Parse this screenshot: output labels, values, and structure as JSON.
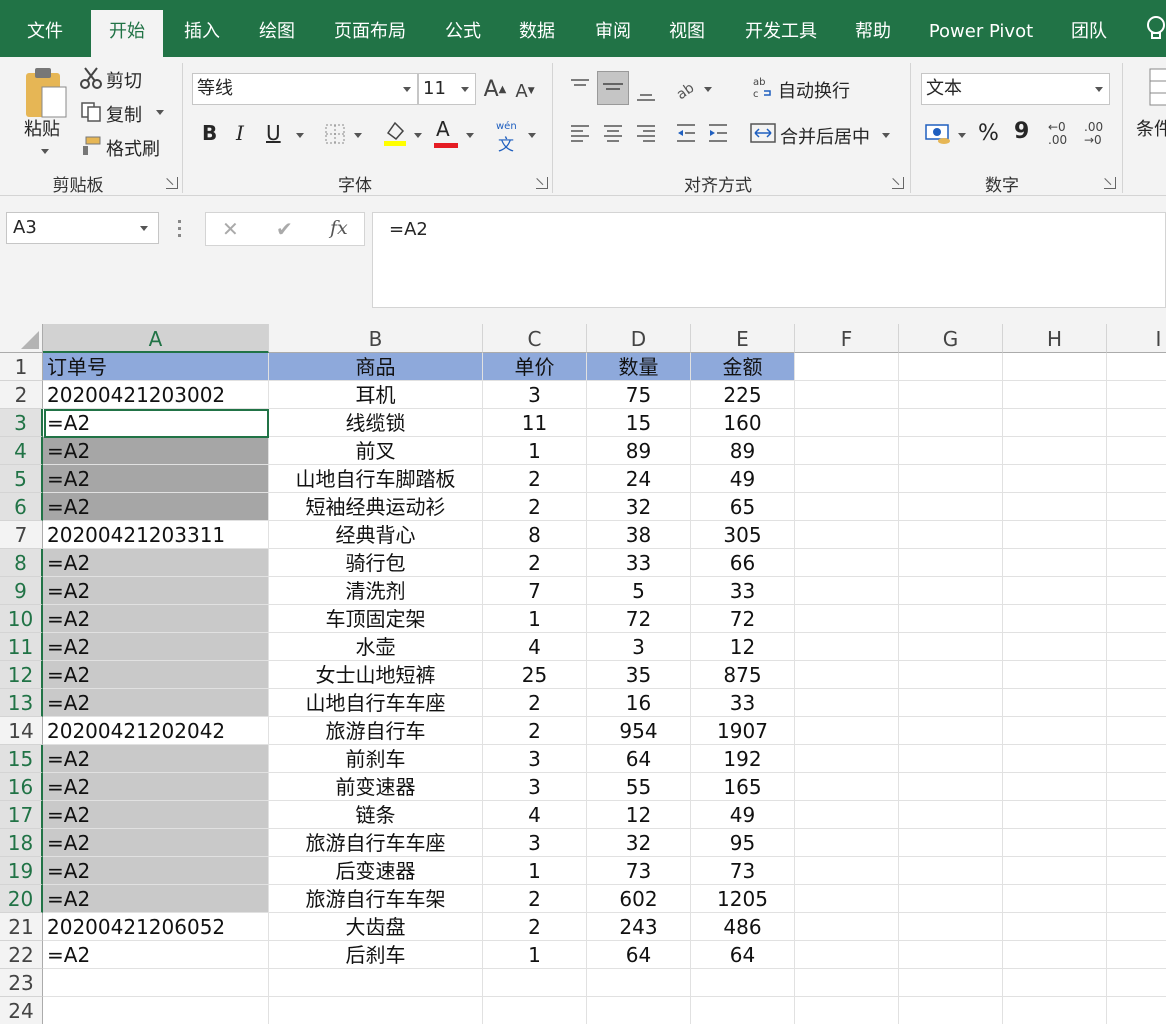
{
  "tabs": [
    "文件",
    "开始",
    "插入",
    "绘图",
    "页面布局",
    "公式",
    "数据",
    "审阅",
    "视图",
    "开发工具",
    "帮助",
    "Power Pivot",
    "团队"
  ],
  "active_tab": "开始",
  "ribbon": {
    "clipboard": {
      "paste": "粘贴",
      "cut": "剪切",
      "copy": "复制",
      "format_painter": "格式刷",
      "title": "剪贴板"
    },
    "font": {
      "font_name": "等线",
      "font_size": "11",
      "bold": "B",
      "italic": "I",
      "underline": "U",
      "phonetic_top": "wén",
      "phonetic_bottom": "文",
      "title": "字体",
      "font_color": "#e51c23"
    },
    "alignment": {
      "wrap_text": "自动换行",
      "merge_center": "合并后居中",
      "title": "对齐方式"
    },
    "number": {
      "format": "文本",
      "percent": "%",
      "comma": "9",
      "inc_decimal_top": "←0",
      "inc_decimal_bottom": ".00",
      "dec_decimal_top": ".00",
      "dec_decimal_bottom": "→0",
      "title": "数字"
    },
    "styles": {
      "conditional_partial": "条件"
    }
  },
  "namebox": "A3",
  "formula_bar": {
    "cancel": "✕",
    "enter": "✔",
    "fx": "fx",
    "content": "=A2"
  },
  "columns": [
    "A",
    "B",
    "C",
    "D",
    "E",
    "F",
    "G",
    "H",
    "I"
  ],
  "selected_column": "A",
  "rows": [
    {
      "num": "1",
      "style": "hdr",
      "cells": [
        "订单号",
        "商品",
        "单价",
        "数量",
        "金额"
      ]
    },
    {
      "num": "2",
      "style": "none",
      "cells": [
        "20200421203002",
        "耳机",
        "3",
        "75",
        "225"
      ]
    },
    {
      "num": "3",
      "style": "active",
      "cells": [
        "=A2",
        "线缆锁",
        "11",
        "15",
        "160"
      ]
    },
    {
      "num": "4",
      "style": "dark",
      "cells": [
        "=A2",
        "前叉",
        "1",
        "89",
        "89"
      ]
    },
    {
      "num": "5",
      "style": "dark",
      "cells": [
        "=A2",
        "山地自行车脚踏板",
        "2",
        "24",
        "49"
      ]
    },
    {
      "num": "6",
      "style": "dark",
      "cells": [
        "=A2",
        "短袖经典运动衫",
        "2",
        "32",
        "65"
      ]
    },
    {
      "num": "7",
      "style": "none",
      "cells": [
        "20200421203311",
        "经典背心",
        "8",
        "38",
        "305"
      ]
    },
    {
      "num": "8",
      "style": "light",
      "cells": [
        "=A2",
        "骑行包",
        "2",
        "33",
        "66"
      ]
    },
    {
      "num": "9",
      "style": "light",
      "cells": [
        "=A2",
        "清洗剂",
        "7",
        "5",
        "33"
      ]
    },
    {
      "num": "10",
      "style": "light",
      "cells": [
        "=A2",
        "车顶固定架",
        "1",
        "72",
        "72"
      ]
    },
    {
      "num": "11",
      "style": "light",
      "cells": [
        "=A2",
        "水壶",
        "4",
        "3",
        "12"
      ]
    },
    {
      "num": "12",
      "style": "light",
      "cells": [
        "=A2",
        "女士山地短裤",
        "25",
        "35",
        "875"
      ]
    },
    {
      "num": "13",
      "style": "light",
      "cells": [
        "=A2",
        "山地自行车车座",
        "2",
        "16",
        "33"
      ]
    },
    {
      "num": "14",
      "style": "none",
      "cells": [
        "20200421202042",
        "旅游自行车",
        "2",
        "954",
        "1907"
      ]
    },
    {
      "num": "15",
      "style": "light",
      "cells": [
        "=A2",
        "前刹车",
        "3",
        "64",
        "192"
      ]
    },
    {
      "num": "16",
      "style": "light",
      "cells": [
        "=A2",
        "前变速器",
        "3",
        "55",
        "165"
      ]
    },
    {
      "num": "17",
      "style": "light",
      "cells": [
        "=A2",
        "链条",
        "4",
        "12",
        "49"
      ]
    },
    {
      "num": "18",
      "style": "light",
      "cells": [
        "=A2",
        "旅游自行车车座",
        "3",
        "32",
        "95"
      ]
    },
    {
      "num": "19",
      "style": "light",
      "cells": [
        "=A2",
        "后变速器",
        "1",
        "73",
        "73"
      ]
    },
    {
      "num": "20",
      "style": "light",
      "cells": [
        "=A2",
        "旅游自行车车架",
        "2",
        "602",
        "1205"
      ]
    },
    {
      "num": "21",
      "style": "none",
      "cells": [
        "20200421206052",
        "大齿盘",
        "2",
        "243",
        "486"
      ]
    },
    {
      "num": "22",
      "style": "none",
      "cells": [
        "=A2",
        "后刹车",
        "1",
        "64",
        "64"
      ]
    },
    {
      "num": "23",
      "style": "none",
      "cells": [
        "",
        "",
        "",
        "",
        ""
      ]
    },
    {
      "num": "24",
      "style": "none",
      "cells": [
        "",
        "",
        "",
        "",
        ""
      ]
    }
  ],
  "colors": {
    "excel_green": "#217346",
    "header_fill": "#8ea9db",
    "dark_fill": "#a6a6a6",
    "light_fill": "#c9c9c9"
  }
}
